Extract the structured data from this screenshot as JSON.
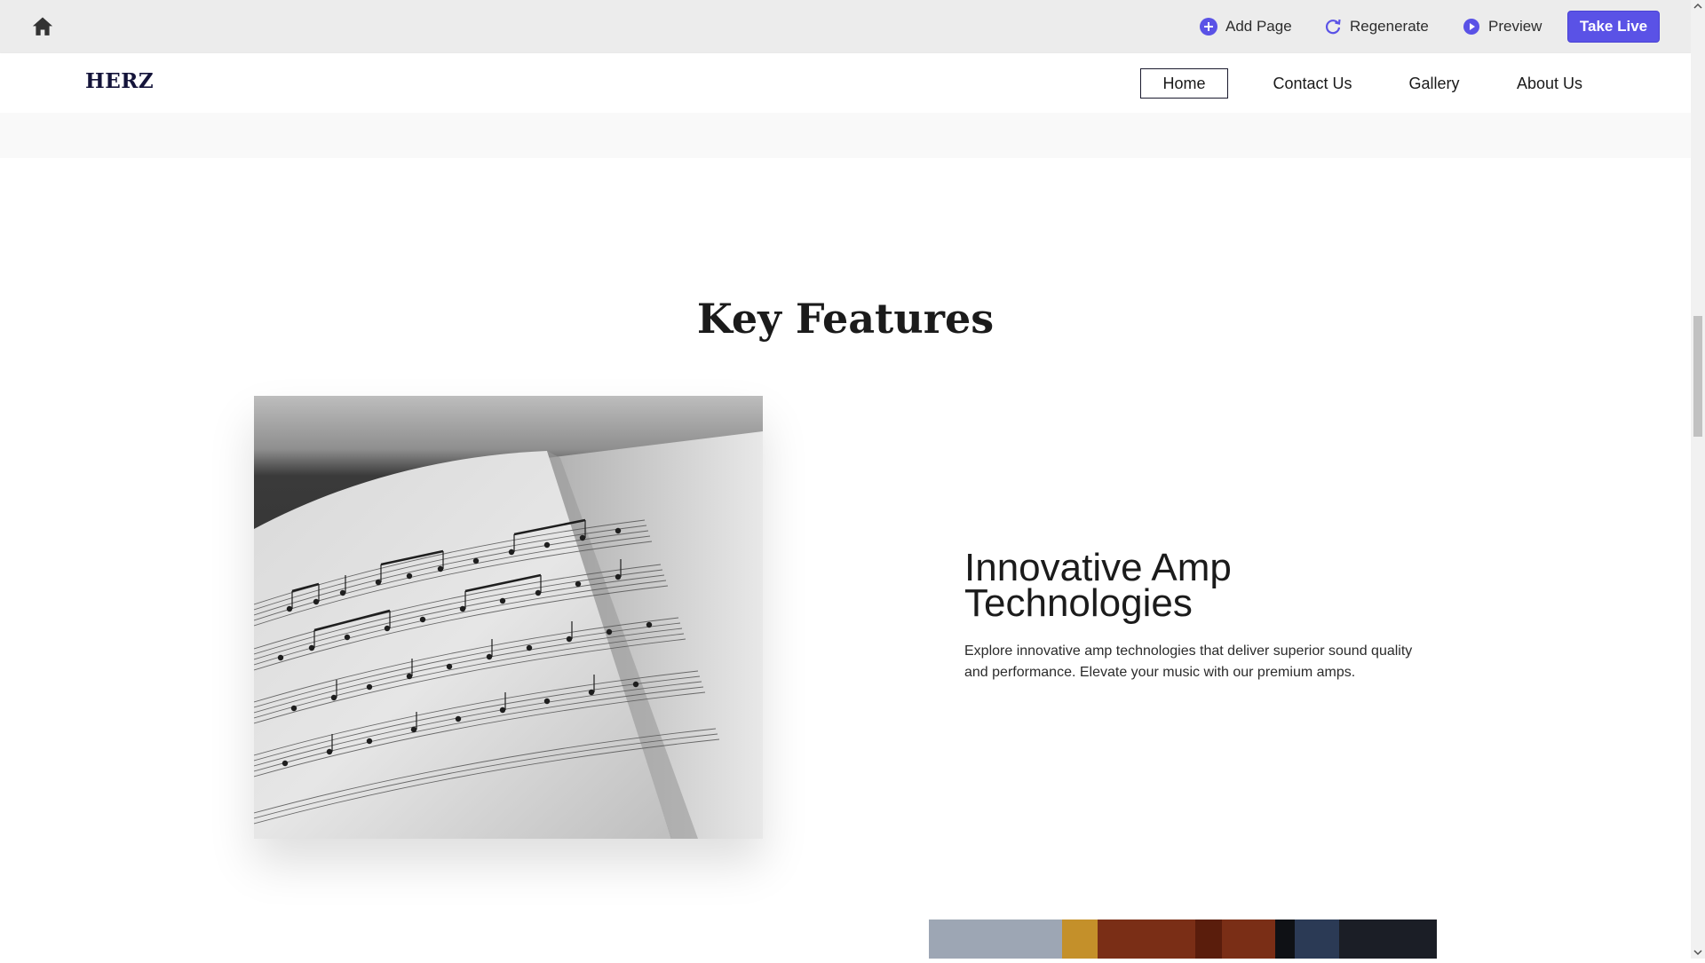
{
  "toolbar": {
    "home_icon": "home-icon",
    "add_page_label": "Add Page",
    "regenerate_label": "Regenerate",
    "preview_label": "Preview",
    "take_live_label": "Take Live",
    "accent_color": "#5a52e6"
  },
  "site": {
    "logo": "HERZ",
    "nav": [
      {
        "label": "Home",
        "active": true
      },
      {
        "label": "Contact Us",
        "active": false
      },
      {
        "label": "Gallery",
        "active": false
      },
      {
        "label": "About Us",
        "active": false
      }
    ]
  },
  "section": {
    "title": "Key Features",
    "feature": {
      "title": "Innovative Amp Technologies",
      "description": "Explore innovative amp technologies that deliver superior sound quality and performance. Elevate your music with our premium amps."
    }
  }
}
